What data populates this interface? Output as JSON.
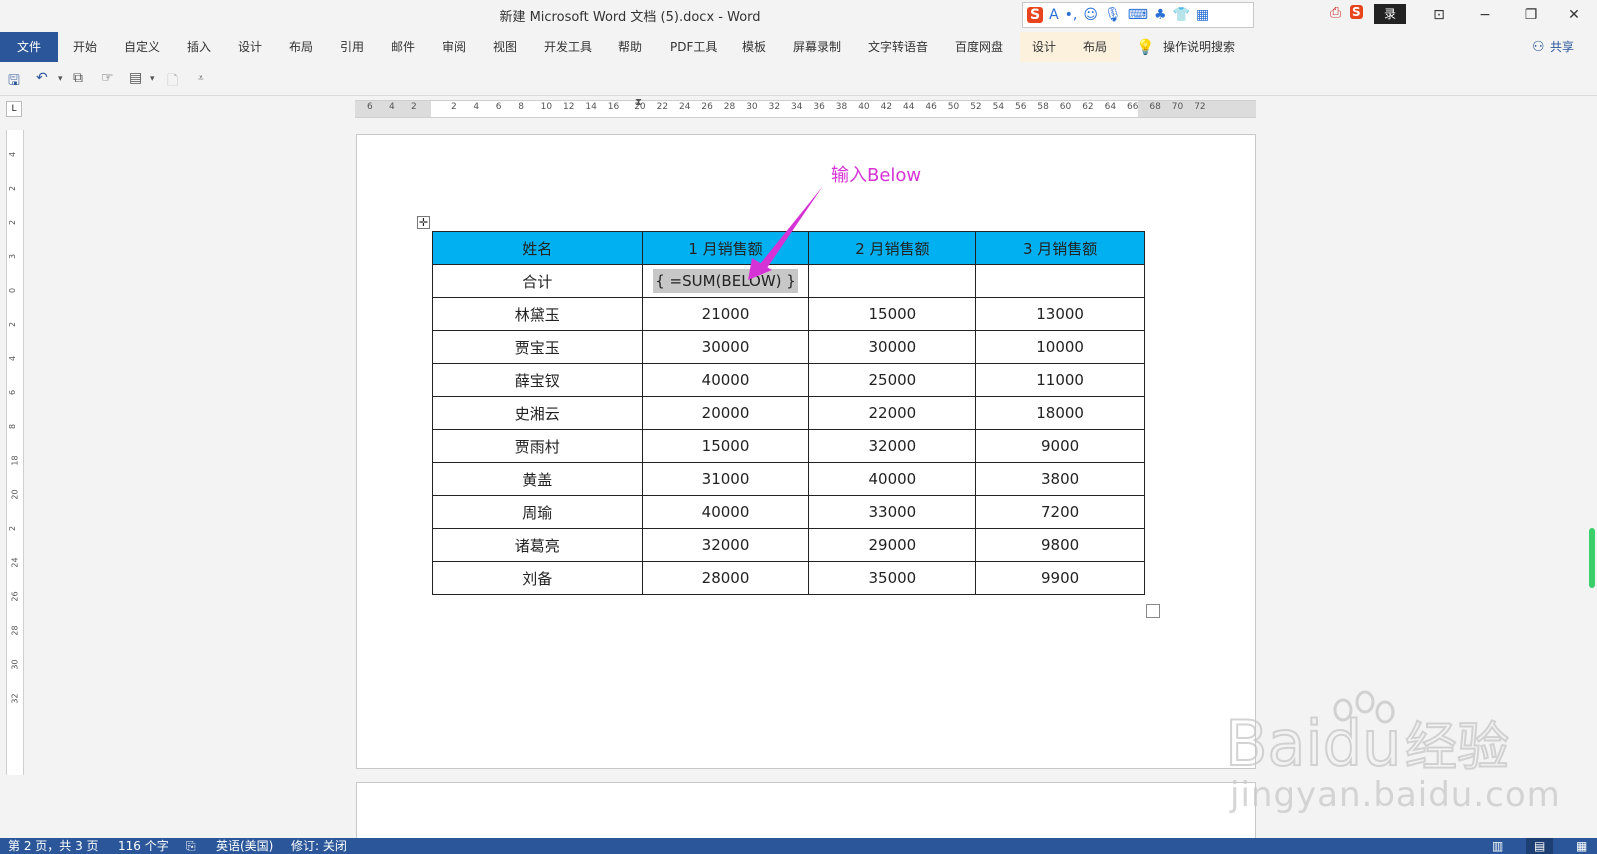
{
  "title_bar": {
    "title": "新建 Microsoft Word 文档 (5).docx  -  Word",
    "login": "录",
    "ime_icons": [
      "S",
      "A",
      "•,",
      "☺",
      "🎙",
      "⌨",
      "♣",
      "👕",
      "▦"
    ]
  },
  "window_buttons": [
    "⊡",
    "−",
    "❐",
    "✕"
  ],
  "ribbon": {
    "file_tab": "文件",
    "tabs": [
      "开始",
      "自定义",
      "插入",
      "设计",
      "布局",
      "引用",
      "邮件",
      "审阅",
      "视图",
      "开发工具",
      "帮助",
      "PDF工具",
      "模板",
      "屏幕录制",
      "文字转语音",
      "百度网盘"
    ],
    "context_tabs": [
      "设计",
      "布局"
    ],
    "tell_me": "操作说明搜索",
    "share": "共享"
  },
  "ruler": {
    "h_left_ticks": [
      "6",
      "4",
      "2"
    ],
    "h_ticks": [
      "2",
      "4",
      "6",
      "8",
      "10",
      "12",
      "14",
      "16",
      "20",
      "22",
      "24",
      "26",
      "28",
      "30",
      "32",
      "34",
      "36",
      "38",
      "40",
      "42",
      "44",
      "46",
      "50",
      "52",
      "54",
      "56",
      "58",
      "60",
      "62",
      "64",
      "66",
      "68",
      "70",
      "72"
    ],
    "v_ticks": [
      "4",
      "2",
      "2",
      "3",
      "0",
      "2",
      "4",
      "6",
      "8",
      "18",
      "20",
      "2",
      "24",
      "26",
      "28",
      "30",
      "32"
    ]
  },
  "annotation": "输入Below",
  "table": {
    "headers": [
      "姓名",
      "1 月销售额",
      "2 月销售额",
      "3 月销售额"
    ],
    "total_row": {
      "label": "合计",
      "field_code": "{ =SUM(BELOW) }",
      "c2": "",
      "c3": ""
    },
    "rows": [
      [
        "林黛玉",
        "21000",
        "15000",
        "13000"
      ],
      [
        "贾宝玉",
        "30000",
        "30000",
        "10000"
      ],
      [
        "薛宝钗",
        "40000",
        "25000",
        "11000"
      ],
      [
        "史湘云",
        "20000",
        "22000",
        "18000"
      ],
      [
        "贾雨村",
        "15000",
        "32000",
        "9000"
      ],
      [
        "黄盖",
        "31000",
        "40000",
        "3800"
      ],
      [
        "周瑜",
        "40000",
        "33000",
        "7200"
      ],
      [
        "诸葛亮",
        "32000",
        "29000",
        "9800"
      ],
      [
        "刘备",
        "28000",
        "35000",
        "9900"
      ]
    ]
  },
  "status_bar": {
    "page": "第 2 页，共 3 页",
    "words": "116 个字",
    "language": "英语(美国)",
    "track": "修订: 关闭"
  },
  "watermark": {
    "brand": "Baidu",
    "cn": "经验",
    "url": "jingyan.baidu.com"
  },
  "colors": {
    "file_tab": "#2b579a",
    "header_fill": "#00b0f0",
    "annotation": "#d633d6",
    "status_bar": "#2b579a"
  }
}
